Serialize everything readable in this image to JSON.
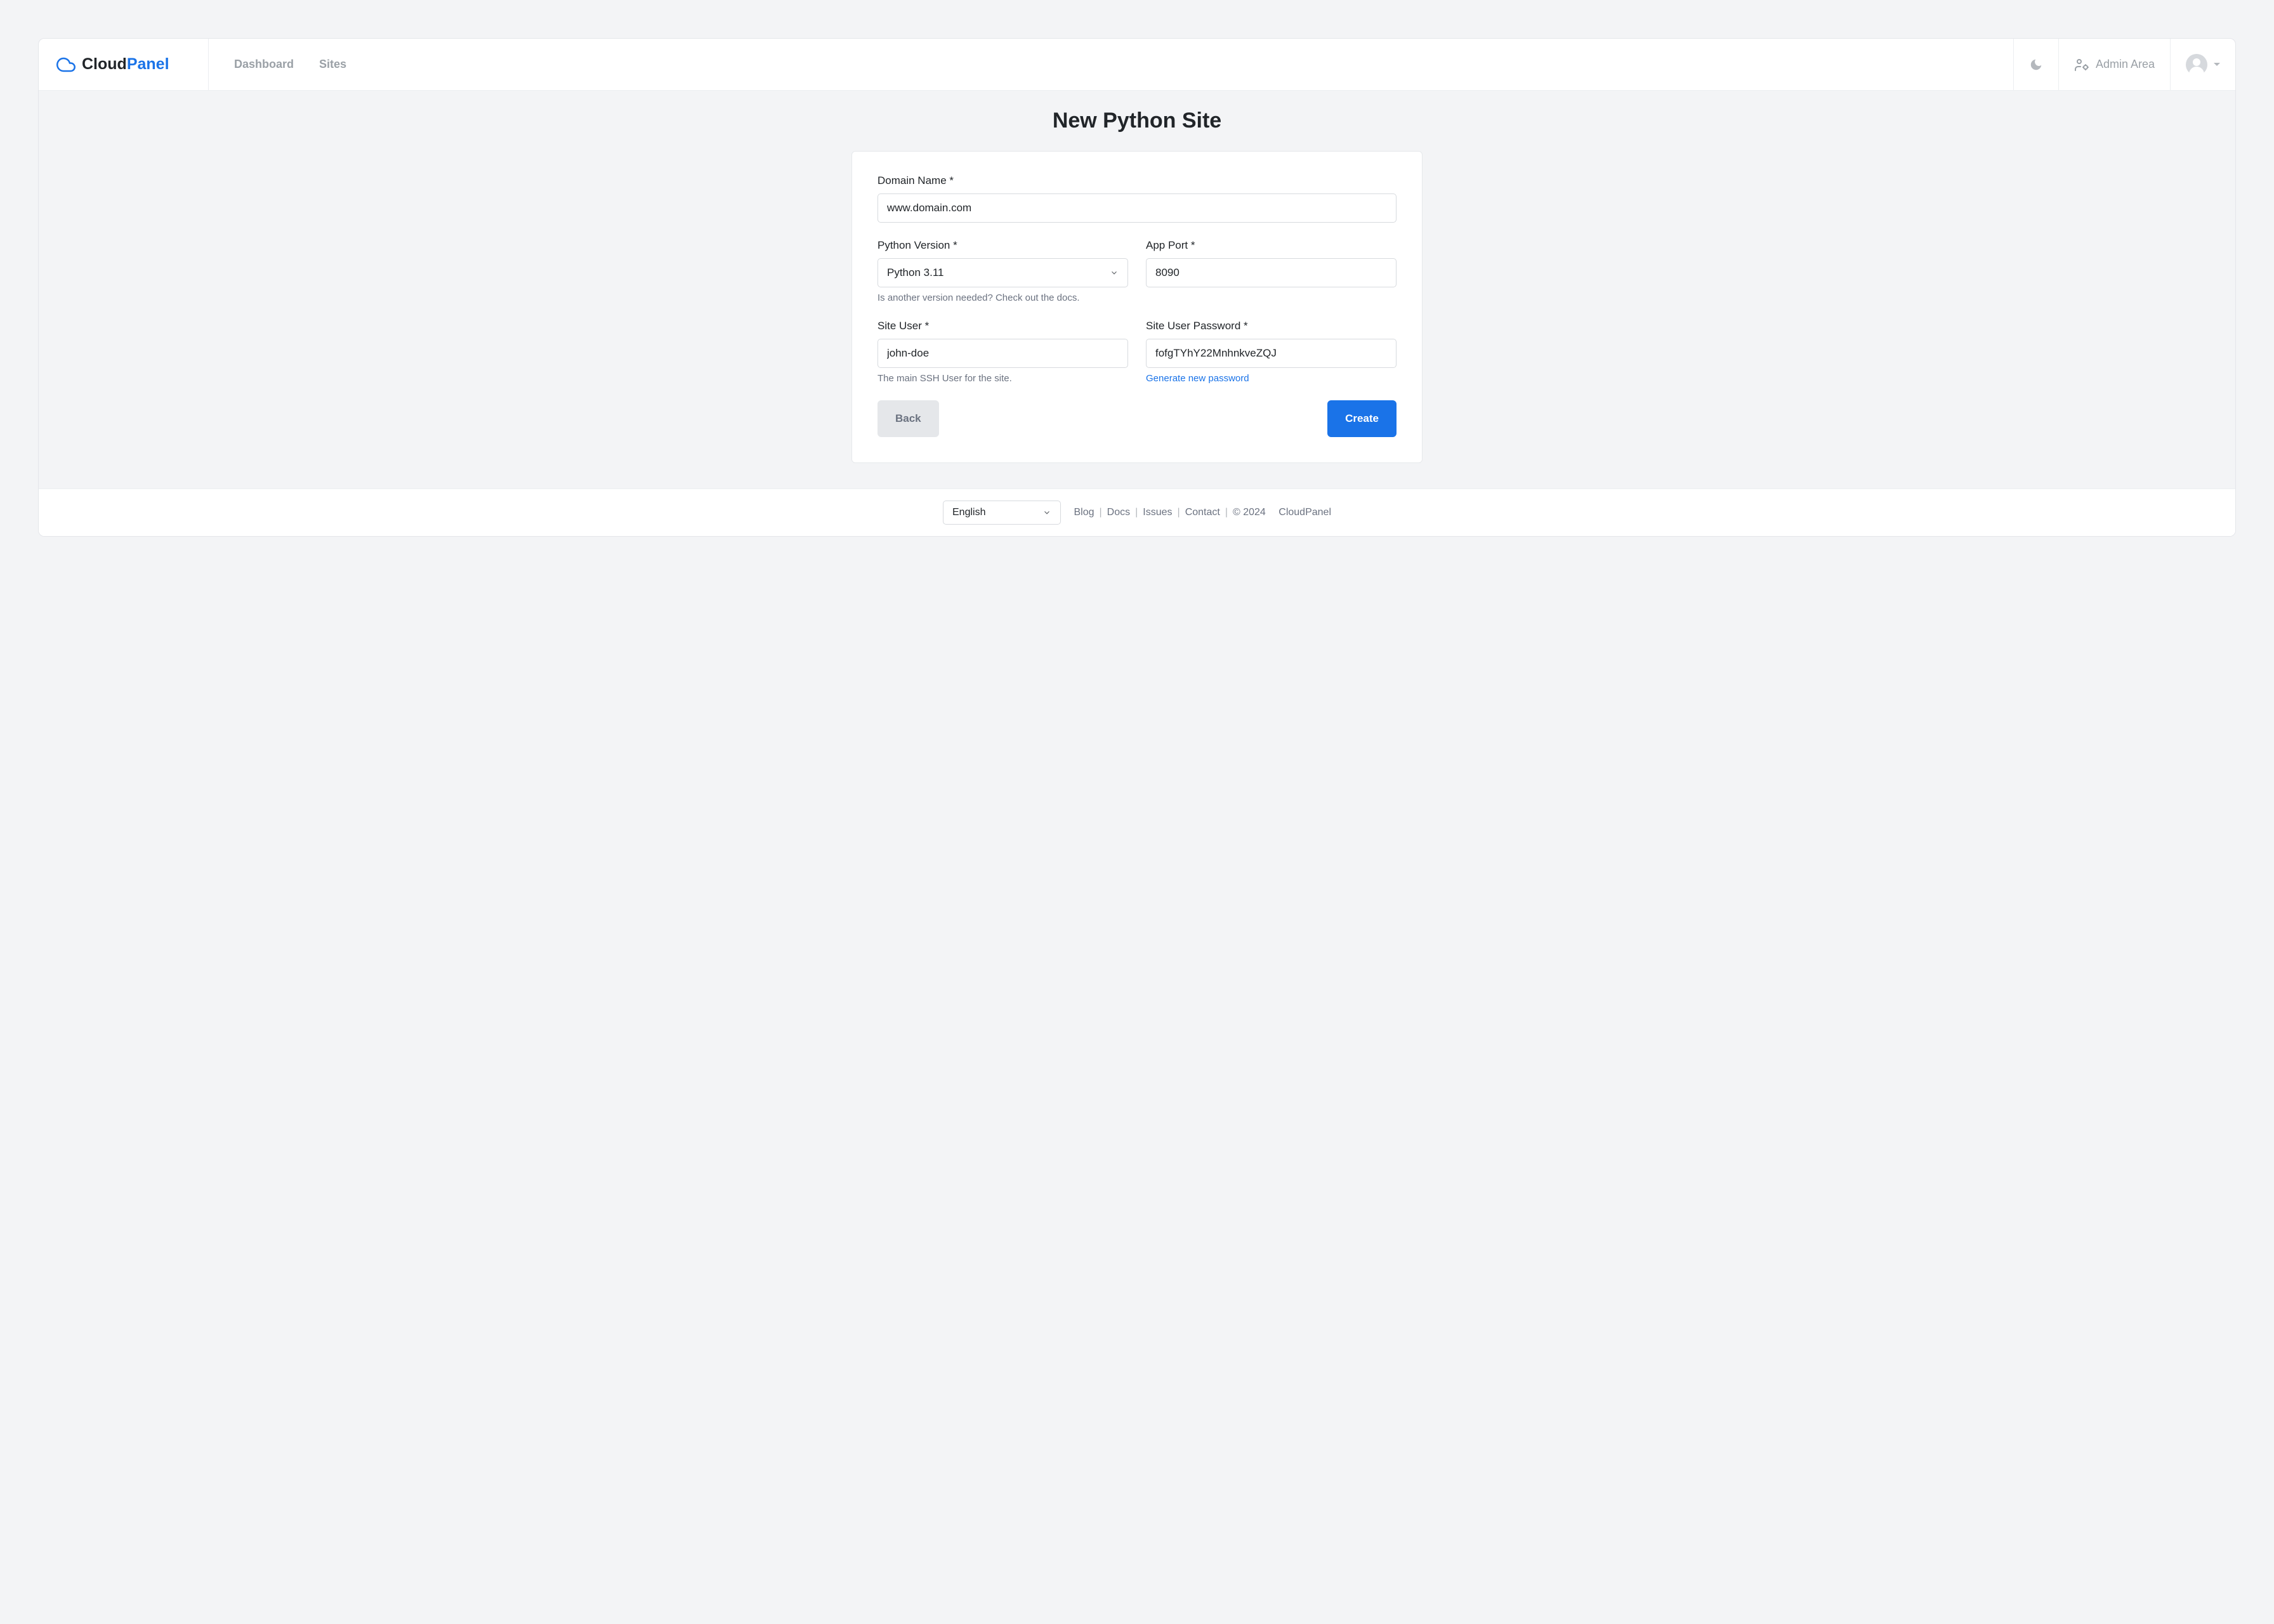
{
  "brand": {
    "part1": "Cloud",
    "part2": "Panel"
  },
  "nav": {
    "dashboard": "Dashboard",
    "sites": "Sites"
  },
  "adminArea": "Admin Area",
  "page": {
    "title": "New Python Site"
  },
  "form": {
    "domainName": {
      "label": "Domain Name *",
      "value": "www.domain.com"
    },
    "pythonVersion": {
      "label": "Python Version *",
      "value": "Python 3.11",
      "hint": "Is another version needed? Check out the docs."
    },
    "appPort": {
      "label": "App Port *",
      "value": "8090"
    },
    "siteUser": {
      "label": "Site User *",
      "value": "john-doe",
      "hint": "The main SSH User for the site."
    },
    "siteUserPassword": {
      "label": "Site User Password *",
      "value": "fofgTYhY22MnhnkveZQJ",
      "linkText": "Generate new password"
    }
  },
  "buttons": {
    "back": "Back",
    "create": "Create"
  },
  "footer": {
    "language": "English",
    "links": {
      "blog": "Blog",
      "docs": "Docs",
      "issues": "Issues",
      "contact": "Contact"
    },
    "copyright": "© 2024",
    "brand": "CloudPanel"
  }
}
